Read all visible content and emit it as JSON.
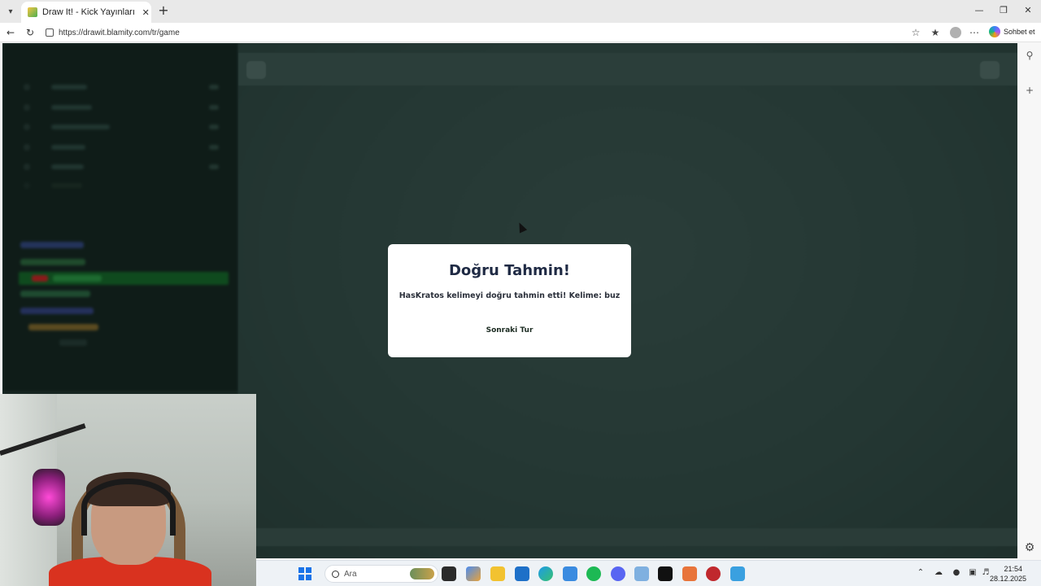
{
  "browser": {
    "tab_title": "Draw It! - Kick Yayınları İçin Çizim",
    "url": "https://drawit.blamity.com/tr/game",
    "copilot_label": "Sohbet et"
  },
  "modal": {
    "title": "Doğru Tahmin!",
    "message": "HasKratos kelimeyi doğru tahmin etti! Kelime: buz",
    "next_button": "Sonraki Tur"
  },
  "taskbar": {
    "search_placeholder": "Ara",
    "time": "21:54",
    "date": "28.12.2025"
  },
  "icons": {
    "tab_list": "chevron-down-icon",
    "back": "arrow-left-icon",
    "refresh": "refresh-icon",
    "favorite": "star-icon",
    "collections": "collections-icon",
    "more": "more-icon",
    "sidebar_search": "search-icon",
    "sidebar_add": "plus-icon",
    "settings": "gear-icon"
  },
  "colors": {
    "page_bg": "#233532",
    "left_panel": "#0f1c18",
    "modal_bg": "#ffffff",
    "modal_title": "#1f2a44",
    "chat_highlight": "#0f4a1e"
  }
}
